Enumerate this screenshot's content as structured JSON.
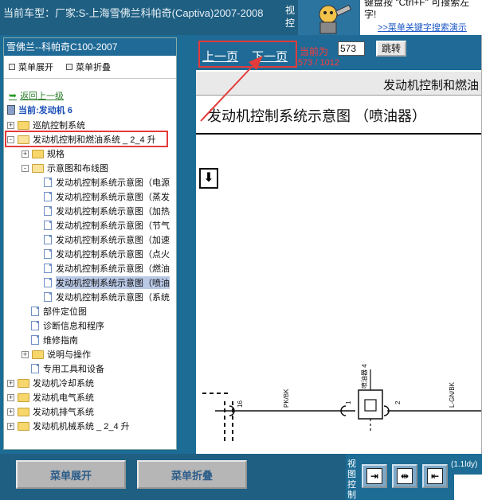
{
  "header": {
    "vehicle": "当前车型：厂家:S-上海雪佛兰科帕奇(Captiva)2007-2008",
    "view_ctl": "视控",
    "tip_line1": "键盘按 \"Ctrl+F\" 可搜索左",
    "tip_line2": "字!",
    "search_link": ">>菜单关键字搜索演示"
  },
  "sidebar": {
    "model": "雪佛兰--科帕奇C100-2007",
    "expand_menu": "菜单展开",
    "collapse_menu": "菜单折叠",
    "back": "返回上一级",
    "current": "当前:发动机 6",
    "tree": [
      {
        "label": "巡航控制系统",
        "type": "folder",
        "expander": "+"
      },
      {
        "label": "发动机控制和燃油系统 _ 2_4 升",
        "type": "folder",
        "expander": "-",
        "open": true
      },
      {
        "label": "规格",
        "type": "folder",
        "expander": "+"
      },
      {
        "label": "示意图和布线图",
        "type": "folder",
        "expander": "-",
        "open": true
      },
      {
        "label": "发动机控制系统示意图（电源",
        "type": "doc"
      },
      {
        "label": "发动机控制系统示意图（蒸发",
        "type": "doc"
      },
      {
        "label": "发动机控制系统示意图（加热",
        "type": "doc"
      },
      {
        "label": "发动机控制系统示意图（节气",
        "type": "doc"
      },
      {
        "label": "发动机控制系统示意图（加速",
        "type": "doc"
      },
      {
        "label": "发动机控制系统示意图（点火",
        "type": "doc"
      },
      {
        "label": "发动机控制系统示意图（燃油",
        "type": "doc"
      },
      {
        "label": "发动机控制系统示意图（喷油",
        "type": "doc",
        "selected": true
      },
      {
        "label": "发动机控制系统示意图（系统",
        "type": "doc"
      },
      {
        "label": "部件定位图",
        "type": "doc"
      },
      {
        "label": "诊断信息和程序",
        "type": "doc"
      },
      {
        "label": "维修指南",
        "type": "doc"
      },
      {
        "label": "说明与操作",
        "type": "folder",
        "expander": "+"
      },
      {
        "label": "专用工具和设备",
        "type": "doc"
      },
      {
        "label": "发动机冷却系统",
        "type": "folder",
        "expander": "+"
      },
      {
        "label": "发动机电气系统",
        "type": "folder",
        "expander": "+"
      },
      {
        "label": "发动机排气系统",
        "type": "folder",
        "expander": "+"
      },
      {
        "label": "发动机机械系统 _ 2_4 升",
        "type": "folder",
        "expander": "+"
      }
    ]
  },
  "footer": {
    "expand_button": "菜单展开",
    "collapse_button": "菜单折叠",
    "view_ctl2": "视图控制",
    "side_text": "(1.1ldy)"
  },
  "viewer": {
    "prev": "上一页",
    "next": "下一页",
    "current_label": "当前为",
    "page_value": "573",
    "jump": "跳转",
    "pages": "573 / 1012",
    "section": "发动机控制和燃油",
    "doc_title": "发动机控制系统示意图 （喷油器）",
    "down_icon": "arrow-down-icon"
  },
  "diagram": {
    "wire1": "PK/BK",
    "wire2": "L-GN/BK",
    "component": "喷油器 4",
    "pin_a": "16",
    "pin_b": "1",
    "pin_c": "2"
  },
  "colors": {
    "highlight": "#e43b3b",
    "panel_blue": "#1f6a96",
    "page_red": "#ff3b3b"
  }
}
